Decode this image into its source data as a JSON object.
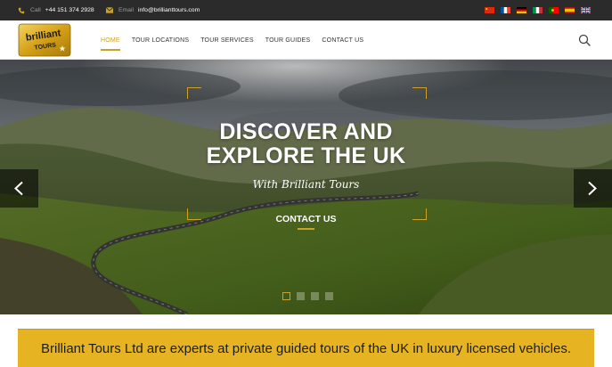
{
  "topbar": {
    "phone_label": "Call",
    "phone": "+44 151 374 2928",
    "email_label": "Email",
    "email": "info@brillianttours.com",
    "flags": [
      "china-flag",
      "france-flag",
      "germany-flag",
      "italy-flag",
      "portugal-flag",
      "spain-flag",
      "uk-flag"
    ]
  },
  "logo": {
    "line1": "brilliant",
    "line2": "TOURS"
  },
  "nav": {
    "items": [
      {
        "label": "HOME",
        "active": true
      },
      {
        "label": "TOUR LOCATIONS",
        "active": false
      },
      {
        "label": "TOUR SERVICES",
        "active": false
      },
      {
        "label": "TOUR GUIDES",
        "active": false
      },
      {
        "label": "CONTACT US",
        "active": false
      }
    ]
  },
  "hero": {
    "title_line1": "DISCOVER AND",
    "title_line2": "EXPLORE THE UK",
    "subtitle": "With Brilliant Tours",
    "cta": "CONTACT US",
    "slides": 4,
    "active_slide": 1
  },
  "banner": {
    "text": "Brilliant Tours Ltd are experts at private guided tours of the UK in luxury licensed vehicles."
  },
  "colors": {
    "accent": "#c9a227",
    "banner": "#e6b422",
    "topbar": "#2b2b2b"
  }
}
